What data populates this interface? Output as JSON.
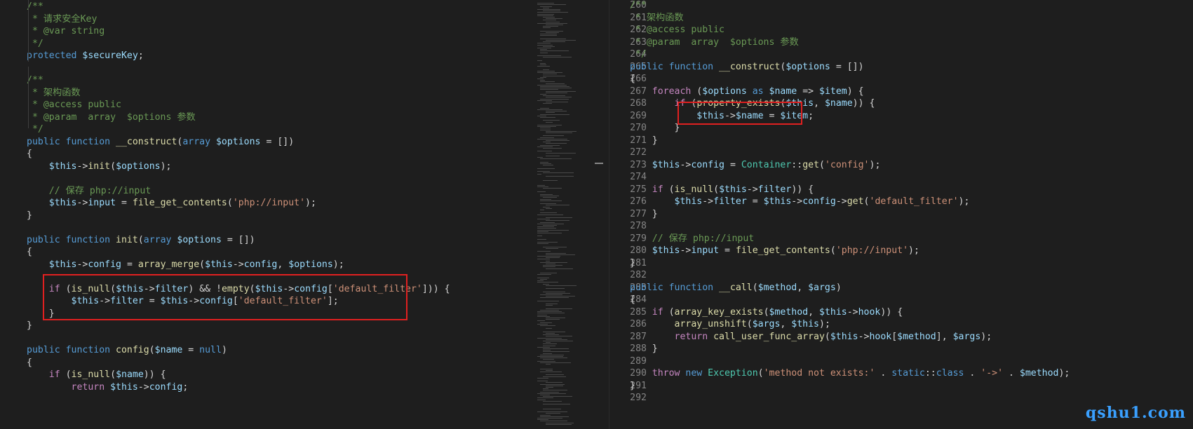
{
  "left_pane": {
    "lines": [
      [
        [
          "c-com",
          "/**"
        ]
      ],
      [
        [
          "c-com",
          " * 请求安全Key"
        ]
      ],
      [
        [
          "c-com",
          " * @var string"
        ]
      ],
      [
        [
          "c-com",
          " */"
        ]
      ],
      [
        [
          "c-kw",
          "protected "
        ],
        [
          "c-var",
          "$secureKey"
        ],
        [
          "c-txt",
          ";"
        ]
      ],
      [],
      [
        [
          "c-com",
          "/**"
        ]
      ],
      [
        [
          "c-com",
          " * 架构函数"
        ]
      ],
      [
        [
          "c-com",
          " * @access public"
        ]
      ],
      [
        [
          "c-com",
          " * @param  array  $options 参数"
        ]
      ],
      [
        [
          "c-com",
          " */"
        ]
      ],
      [
        [
          "c-kw",
          "public function "
        ],
        [
          "c-fn",
          "__construct"
        ],
        [
          "c-txt",
          "("
        ],
        [
          "c-kw",
          "array "
        ],
        [
          "c-var",
          "$options"
        ],
        [
          "c-txt",
          " = [])"
        ]
      ],
      [
        [
          "c-txt",
          "{"
        ]
      ],
      [
        [
          "c-txt",
          "    "
        ],
        [
          "c-var",
          "$this"
        ],
        [
          "c-txt",
          "->"
        ],
        [
          "c-fn",
          "init"
        ],
        [
          "c-txt",
          "("
        ],
        [
          "c-var",
          "$options"
        ],
        [
          "c-txt",
          ");"
        ]
      ],
      [],
      [
        [
          "c-txt",
          "    "
        ],
        [
          "c-com",
          "// 保存 php://input"
        ]
      ],
      [
        [
          "c-txt",
          "    "
        ],
        [
          "c-var",
          "$this"
        ],
        [
          "c-txt",
          "->"
        ],
        [
          "c-var",
          "input"
        ],
        [
          "c-txt",
          " = "
        ],
        [
          "c-fn",
          "file_get_contents"
        ],
        [
          "c-txt",
          "("
        ],
        [
          "c-str",
          "'php://input'"
        ],
        [
          "c-txt",
          ");"
        ]
      ],
      [
        [
          "c-txt",
          "}"
        ]
      ],
      [],
      [
        [
          "c-kw",
          "public function "
        ],
        [
          "c-fn",
          "init"
        ],
        [
          "c-txt",
          "("
        ],
        [
          "c-kw",
          "array "
        ],
        [
          "c-var",
          "$options"
        ],
        [
          "c-txt",
          " = [])"
        ]
      ],
      [
        [
          "c-txt",
          "{"
        ]
      ],
      [
        [
          "c-txt",
          "    "
        ],
        [
          "c-var",
          "$this"
        ],
        [
          "c-txt",
          "->"
        ],
        [
          "c-var",
          "config"
        ],
        [
          "c-txt",
          " = "
        ],
        [
          "c-fn",
          "array_merge"
        ],
        [
          "c-txt",
          "("
        ],
        [
          "c-var",
          "$this"
        ],
        [
          "c-txt",
          "->"
        ],
        [
          "c-var",
          "config"
        ],
        [
          "c-txt",
          ", "
        ],
        [
          "c-var",
          "$options"
        ],
        [
          "c-txt",
          ");"
        ]
      ],
      [],
      [
        [
          "c-txt",
          "    "
        ],
        [
          "c-ctl",
          "if "
        ],
        [
          "c-txt",
          "("
        ],
        [
          "c-fn",
          "is_null"
        ],
        [
          "c-txt",
          "("
        ],
        [
          "c-var",
          "$this"
        ],
        [
          "c-txt",
          "->"
        ],
        [
          "c-var",
          "filter"
        ],
        [
          "c-txt",
          ") && !"
        ],
        [
          "c-fn",
          "empty"
        ],
        [
          "c-txt",
          "("
        ],
        [
          "c-var",
          "$this"
        ],
        [
          "c-txt",
          "->"
        ],
        [
          "c-var",
          "config"
        ],
        [
          "c-txt",
          "["
        ],
        [
          "c-str",
          "'default_filter'"
        ],
        [
          "c-txt",
          "])) {"
        ]
      ],
      [
        [
          "c-txt",
          "        "
        ],
        [
          "c-var",
          "$this"
        ],
        [
          "c-txt",
          "->"
        ],
        [
          "c-var",
          "filter"
        ],
        [
          "c-txt",
          " = "
        ],
        [
          "c-var",
          "$this"
        ],
        [
          "c-txt",
          "->"
        ],
        [
          "c-var",
          "config"
        ],
        [
          "c-txt",
          "["
        ],
        [
          "c-str",
          "'default_filter'"
        ],
        [
          "c-txt",
          "];"
        ]
      ],
      [
        [
          "c-txt",
          "    }"
        ]
      ],
      [
        [
          "c-txt",
          "}"
        ]
      ],
      [],
      [
        [
          "c-kw",
          "public function "
        ],
        [
          "c-fn",
          "config"
        ],
        [
          "c-txt",
          "("
        ],
        [
          "c-var",
          "$name"
        ],
        [
          "c-txt",
          " = "
        ],
        [
          "c-kw",
          "null"
        ],
        [
          "c-txt",
          ")"
        ]
      ],
      [
        [
          "c-txt",
          "{"
        ]
      ],
      [
        [
          "c-txt",
          "    "
        ],
        [
          "c-ctl",
          "if "
        ],
        [
          "c-txt",
          "("
        ],
        [
          "c-fn",
          "is_null"
        ],
        [
          "c-txt",
          "("
        ],
        [
          "c-var",
          "$name"
        ],
        [
          "c-txt",
          ")) {"
        ]
      ],
      [
        [
          "c-txt",
          "        "
        ],
        [
          "c-ctl",
          "return "
        ],
        [
          "c-var",
          "$this"
        ],
        [
          "c-txt",
          "->"
        ],
        [
          "c-var",
          "config"
        ],
        [
          "c-txt",
          ";"
        ]
      ]
    ]
  },
  "right_pane": {
    "line_numbers": [
      "260",
      "261",
      "262",
      "263",
      "264",
      "265",
      "266",
      "267",
      "268",
      "269",
      "270",
      "271",
      "272",
      "273",
      "274",
      "275",
      "276",
      "277",
      "278",
      "279",
      "280",
      "281",
      "282",
      "283",
      "284",
      "285",
      "286",
      "287",
      "288",
      "289",
      "290",
      "291",
      "292"
    ],
    "lines": [
      [
        [
          "c-com",
          "/**"
        ]
      ],
      [
        [
          "c-com",
          " * 架构函数"
        ]
      ],
      [
        [
          "c-com",
          " * @access public"
        ]
      ],
      [
        [
          "c-com",
          " * @param  array  $options 参数"
        ]
      ],
      [
        [
          "c-com",
          " */"
        ]
      ],
      [
        [
          "c-kw",
          "public function "
        ],
        [
          "c-fn",
          "__construct"
        ],
        [
          "c-txt",
          "("
        ],
        [
          "c-var",
          "$options"
        ],
        [
          "c-txt",
          " = [])"
        ]
      ],
      [
        [
          "c-txt",
          "{"
        ]
      ],
      [
        [
          "c-txt",
          "    "
        ],
        [
          "c-ctl",
          "foreach "
        ],
        [
          "c-txt",
          "("
        ],
        [
          "c-var",
          "$options"
        ],
        [
          "c-kw",
          " as "
        ],
        [
          "c-var",
          "$name"
        ],
        [
          "c-txt",
          " => "
        ],
        [
          "c-var",
          "$item"
        ],
        [
          "c-txt",
          ") {"
        ]
      ],
      [
        [
          "c-txt",
          "        "
        ],
        [
          "c-ctl",
          "if "
        ],
        [
          "c-txt",
          "("
        ],
        [
          "c-fn",
          "property_exists"
        ],
        [
          "c-txt",
          "("
        ],
        [
          "c-var",
          "$this"
        ],
        [
          "c-txt",
          ", "
        ],
        [
          "c-var",
          "$name"
        ],
        [
          "c-txt",
          ")) {"
        ]
      ],
      [
        [
          "c-txt",
          "            "
        ],
        [
          "c-var",
          "$this"
        ],
        [
          "c-txt",
          "->"
        ],
        [
          "c-var",
          "$name"
        ],
        [
          "c-txt",
          " = "
        ],
        [
          "c-var",
          "$item"
        ],
        [
          "c-txt",
          ";"
        ]
      ],
      [
        [
          "c-txt",
          "        }"
        ]
      ],
      [
        [
          "c-txt",
          "    }"
        ]
      ],
      [],
      [
        [
          "c-txt",
          "    "
        ],
        [
          "c-var",
          "$this"
        ],
        [
          "c-txt",
          "->"
        ],
        [
          "c-var",
          "config"
        ],
        [
          "c-txt",
          " = "
        ],
        [
          "c-cls",
          "Container"
        ],
        [
          "c-txt",
          "::"
        ],
        [
          "c-fn",
          "get"
        ],
        [
          "c-txt",
          "("
        ],
        [
          "c-str",
          "'config'"
        ],
        [
          "c-txt",
          ");"
        ]
      ],
      [],
      [
        [
          "c-txt",
          "    "
        ],
        [
          "c-ctl",
          "if "
        ],
        [
          "c-txt",
          "("
        ],
        [
          "c-fn",
          "is_null"
        ],
        [
          "c-txt",
          "("
        ],
        [
          "c-var",
          "$this"
        ],
        [
          "c-txt",
          "->"
        ],
        [
          "c-var",
          "filter"
        ],
        [
          "c-txt",
          ")) {"
        ]
      ],
      [
        [
          "c-txt",
          "        "
        ],
        [
          "c-var",
          "$this"
        ],
        [
          "c-txt",
          "->"
        ],
        [
          "c-var",
          "filter"
        ],
        [
          "c-txt",
          " = "
        ],
        [
          "c-var",
          "$this"
        ],
        [
          "c-txt",
          "->"
        ],
        [
          "c-var",
          "config"
        ],
        [
          "c-txt",
          "->"
        ],
        [
          "c-fn",
          "get"
        ],
        [
          "c-txt",
          "("
        ],
        [
          "c-str",
          "'default_filter'"
        ],
        [
          "c-txt",
          ");"
        ]
      ],
      [
        [
          "c-txt",
          "    }"
        ]
      ],
      [],
      [
        [
          "c-txt",
          "    "
        ],
        [
          "c-com",
          "// 保存 php://input"
        ]
      ],
      [
        [
          "c-txt",
          "    "
        ],
        [
          "c-var",
          "$this"
        ],
        [
          "c-txt",
          "->"
        ],
        [
          "c-var",
          "input"
        ],
        [
          "c-txt",
          " = "
        ],
        [
          "c-fn",
          "file_get_contents"
        ],
        [
          "c-txt",
          "("
        ],
        [
          "c-str",
          "'php://input'"
        ],
        [
          "c-txt",
          ");"
        ]
      ],
      [
        [
          "c-txt",
          "}"
        ]
      ],
      [],
      [
        [
          "c-kw",
          "public function "
        ],
        [
          "c-fn",
          "__call"
        ],
        [
          "c-txt",
          "("
        ],
        [
          "c-var",
          "$method"
        ],
        [
          "c-txt",
          ", "
        ],
        [
          "c-var",
          "$args"
        ],
        [
          "c-txt",
          ")"
        ]
      ],
      [
        [
          "c-txt",
          "{"
        ]
      ],
      [
        [
          "c-txt",
          "    "
        ],
        [
          "c-ctl",
          "if "
        ],
        [
          "c-txt",
          "("
        ],
        [
          "c-fn",
          "array_key_exists"
        ],
        [
          "c-txt",
          "("
        ],
        [
          "c-var",
          "$method"
        ],
        [
          "c-txt",
          ", "
        ],
        [
          "c-var",
          "$this"
        ],
        [
          "c-txt",
          "->"
        ],
        [
          "c-var",
          "hook"
        ],
        [
          "c-txt",
          ")) {"
        ]
      ],
      [
        [
          "c-txt",
          "        "
        ],
        [
          "c-fn",
          "array_unshift"
        ],
        [
          "c-txt",
          "("
        ],
        [
          "c-var",
          "$args"
        ],
        [
          "c-txt",
          ", "
        ],
        [
          "c-var",
          "$this"
        ],
        [
          "c-txt",
          ");"
        ]
      ],
      [
        [
          "c-txt",
          "        "
        ],
        [
          "c-ctl",
          "return "
        ],
        [
          "c-fn",
          "call_user_func_array"
        ],
        [
          "c-txt",
          "("
        ],
        [
          "c-var",
          "$this"
        ],
        [
          "c-txt",
          "->"
        ],
        [
          "c-var",
          "hook"
        ],
        [
          "c-txt",
          "["
        ],
        [
          "c-var",
          "$method"
        ],
        [
          "c-txt",
          "], "
        ],
        [
          "c-var",
          "$args"
        ],
        [
          "c-txt",
          ");"
        ]
      ],
      [
        [
          "c-txt",
          "    }"
        ]
      ],
      [],
      [
        [
          "c-txt",
          "    "
        ],
        [
          "c-ctl",
          "throw "
        ],
        [
          "c-kw",
          "new "
        ],
        [
          "c-cls",
          "Exception"
        ],
        [
          "c-txt",
          "("
        ],
        [
          "c-str",
          "'method not exists:'"
        ],
        [
          "c-txt",
          " . "
        ],
        [
          "c-kw",
          "static"
        ],
        [
          "c-txt",
          "::"
        ],
        [
          "c-kw",
          "class"
        ],
        [
          "c-txt",
          " . "
        ],
        [
          "c-str",
          "'->'"
        ],
        [
          "c-txt",
          " . "
        ],
        [
          "c-var",
          "$method"
        ],
        [
          "c-txt",
          ");"
        ]
      ],
      [
        [
          "c-txt",
          "}"
        ]
      ],
      []
    ]
  },
  "watermark": "qshu1.com",
  "colors": {
    "highlight_box": "#e02020",
    "background": "#1e1e1e"
  }
}
